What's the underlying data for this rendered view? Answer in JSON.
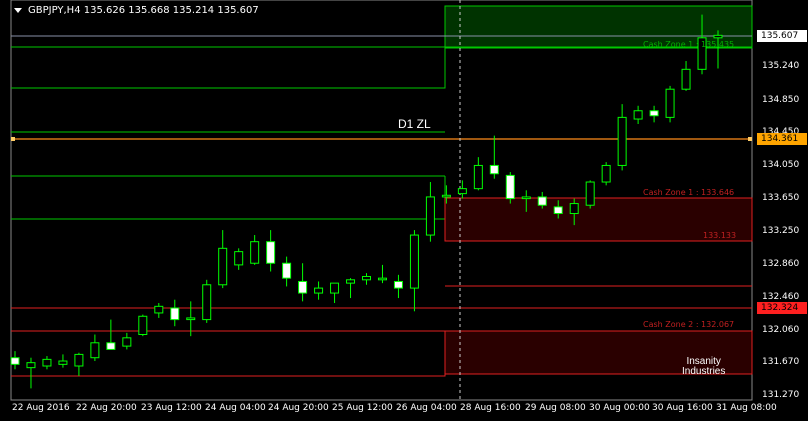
{
  "header": {
    "symbol_info": "GBPJPY,H4  135.626 135.668 135.214 135.607"
  },
  "annotations": {
    "d1_label": "D1 ZL",
    "cash_zone_1_upper": "Cash Zone 1 : 135.435",
    "cash_zone_1_lower": "Cash Zone 1 : 133.646",
    "zone_lower_value": "133.133",
    "cash_zone_2": "Cash Zone 2 : 132.067"
  },
  "price_axis": {
    "ticks": [
      "135.240",
      "134.850",
      "134.450",
      "134.050",
      "133.650",
      "133.250",
      "132.860",
      "132.460",
      "132.060",
      "131.670",
      "131.270"
    ],
    "current_price": "135.607",
    "d1_price": "134.361",
    "red_level": "132.324"
  },
  "time_axis": {
    "labels": [
      "22 Aug 2016",
      "22 Aug 20:00",
      "23 Aug 12:00",
      "24 Aug 04:00",
      "24 Aug 20:00",
      "25 Aug 12:00",
      "26 Aug 04:00",
      "28 Aug 16:00",
      "29 Aug 08:00",
      "30 Aug 00:00",
      "30 Aug 16:00",
      "31 Aug 08:00"
    ]
  },
  "logo": {
    "line1": "Insanity",
    "line2": "Industries"
  },
  "colors": {
    "background": "#000000",
    "bull_candle": "#000000",
    "bear_candle": "#ffffff",
    "wick": "#00ff00",
    "green_zone_line": "#00c800",
    "red_zone_line": "#e02020",
    "d1_line": "#ff8c1a",
    "current_price_tag": "#ffffff",
    "d1_price_tag": "#ffa500",
    "red_price_tag": "#ff2020",
    "grid": "#aaaaaa"
  },
  "candles": [
    {
      "o": 131.72,
      "h": 131.8,
      "l": 131.58,
      "c": 131.64
    },
    {
      "o": 131.6,
      "h": 131.72,
      "l": 131.35,
      "c": 131.66
    },
    {
      "o": 131.62,
      "h": 131.74,
      "l": 131.58,
      "c": 131.7
    },
    {
      "o": 131.64,
      "h": 131.76,
      "l": 131.6,
      "c": 131.68
    },
    {
      "o": 131.62,
      "h": 131.78,
      "l": 131.5,
      "c": 131.76
    },
    {
      "o": 131.72,
      "h": 132.0,
      "l": 131.68,
      "c": 131.9
    },
    {
      "o": 131.9,
      "h": 132.18,
      "l": 131.86,
      "c": 131.82
    },
    {
      "o": 131.86,
      "h": 132.02,
      "l": 131.82,
      "c": 131.96
    },
    {
      "o": 132.0,
      "h": 132.24,
      "l": 131.98,
      "c": 132.22
    },
    {
      "o": 132.26,
      "h": 132.38,
      "l": 132.2,
      "c": 132.34
    },
    {
      "o": 132.32,
      "h": 132.42,
      "l": 132.1,
      "c": 132.18
    },
    {
      "o": 132.18,
      "h": 132.4,
      "l": 131.98,
      "c": 132.2
    },
    {
      "o": 132.18,
      "h": 132.66,
      "l": 132.14,
      "c": 132.6
    },
    {
      "o": 132.6,
      "h": 133.26,
      "l": 132.56,
      "c": 133.04
    },
    {
      "o": 132.84,
      "h": 133.04,
      "l": 132.78,
      "c": 133.0
    },
    {
      "o": 132.86,
      "h": 133.2,
      "l": 132.84,
      "c": 133.12
    },
    {
      "o": 133.12,
      "h": 133.26,
      "l": 132.76,
      "c": 132.86
    },
    {
      "o": 132.86,
      "h": 132.94,
      "l": 132.58,
      "c": 132.68
    },
    {
      "o": 132.64,
      "h": 132.86,
      "l": 132.4,
      "c": 132.5
    },
    {
      "o": 132.5,
      "h": 132.64,
      "l": 132.42,
      "c": 132.56
    },
    {
      "o": 132.5,
      "h": 132.6,
      "l": 132.38,
      "c": 132.62
    },
    {
      "o": 132.62,
      "h": 132.68,
      "l": 132.44,
      "c": 132.66
    },
    {
      "o": 132.66,
      "h": 132.74,
      "l": 132.6,
      "c": 132.7
    },
    {
      "o": 132.66,
      "h": 132.84,
      "l": 132.62,
      "c": 132.68
    },
    {
      "o": 132.64,
      "h": 132.72,
      "l": 132.44,
      "c": 132.56
    },
    {
      "o": 132.56,
      "h": 133.26,
      "l": 132.28,
      "c": 133.2
    },
    {
      "o": 133.2,
      "h": 133.84,
      "l": 133.12,
      "c": 133.66
    },
    {
      "o": 133.66,
      "h": 133.8,
      "l": 133.58,
      "c": 133.68
    },
    {
      "o": 133.7,
      "h": 133.86,
      "l": 133.64,
      "c": 133.76
    },
    {
      "o": 133.76,
      "h": 134.14,
      "l": 133.74,
      "c": 134.04
    },
    {
      "o": 134.04,
      "h": 134.4,
      "l": 133.88,
      "c": 133.94
    },
    {
      "o": 133.92,
      "h": 133.96,
      "l": 133.58,
      "c": 133.64
    },
    {
      "o": 133.64,
      "h": 133.74,
      "l": 133.48,
      "c": 133.66
    },
    {
      "o": 133.66,
      "h": 133.72,
      "l": 133.52,
      "c": 133.56
    },
    {
      "o": 133.54,
      "h": 133.62,
      "l": 133.4,
      "c": 133.46
    },
    {
      "o": 133.46,
      "h": 133.64,
      "l": 133.32,
      "c": 133.58
    },
    {
      "o": 133.56,
      "h": 133.86,
      "l": 133.52,
      "c": 133.84
    },
    {
      "o": 133.84,
      "h": 134.08,
      "l": 133.8,
      "c": 134.04
    },
    {
      "o": 134.04,
      "h": 134.78,
      "l": 133.98,
      "c": 134.62
    },
    {
      "o": 134.6,
      "h": 134.76,
      "l": 134.54,
      "c": 134.7
    },
    {
      "o": 134.7,
      "h": 134.76,
      "l": 134.56,
      "c": 134.64
    },
    {
      "o": 134.62,
      "h": 135.0,
      "l": 134.56,
      "c": 134.96
    },
    {
      "o": 134.96,
      "h": 135.3,
      "l": 134.94,
      "c": 135.2
    },
    {
      "o": 135.2,
      "h": 135.86,
      "l": 135.14,
      "c": 135.58
    },
    {
      "o": 135.58,
      "h": 135.67,
      "l": 135.21,
      "c": 135.61
    }
  ]
}
